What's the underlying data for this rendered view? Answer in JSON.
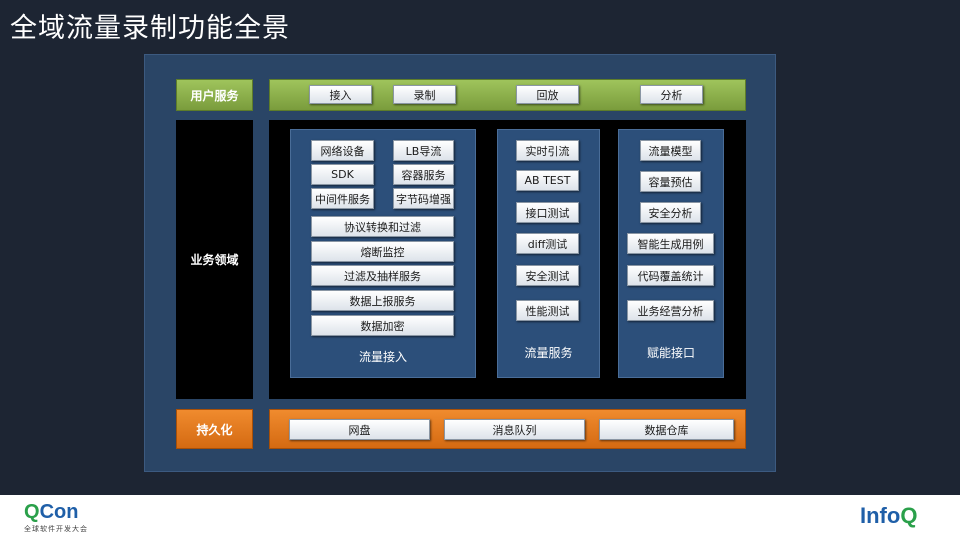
{
  "title": "全域流量录制功能全景",
  "rows": {
    "user_service": {
      "label": "用户服务",
      "items": [
        "接入",
        "录制",
        "回放",
        "分析"
      ]
    },
    "business_domain": {
      "label": "业务领域"
    },
    "persistence": {
      "label": "持久化",
      "items": [
        "网盘",
        "消息队列",
        "数据仓库"
      ]
    }
  },
  "panels": {
    "traffic_ingest": {
      "label": "流量接入",
      "grid": [
        "网络设备",
        "LB导流",
        "SDK",
        "容器服务",
        "中间件服务",
        "字节码增强"
      ],
      "wide": [
        "协议转换和过滤",
        "熔断监控",
        "过滤及抽样服务",
        "数据上报服务",
        "数据加密"
      ]
    },
    "traffic_service": {
      "label": "流量服务",
      "items": [
        "实时引流",
        "AB TEST",
        "接口测试",
        "diff测试",
        "安全测试",
        "性能测试"
      ]
    },
    "enable_interface": {
      "label": "赋能接口",
      "items": [
        "流量模型",
        "容量预估",
        "安全分析",
        "智能生成用例",
        "代码覆盖统计",
        "业务经营分析"
      ]
    }
  },
  "footer": {
    "qcon_q": "Q",
    "qcon_rest": "Con",
    "qcon_sub": "全球软件开发大会",
    "infoq_main": "Info",
    "infoq_q": "Q"
  }
}
